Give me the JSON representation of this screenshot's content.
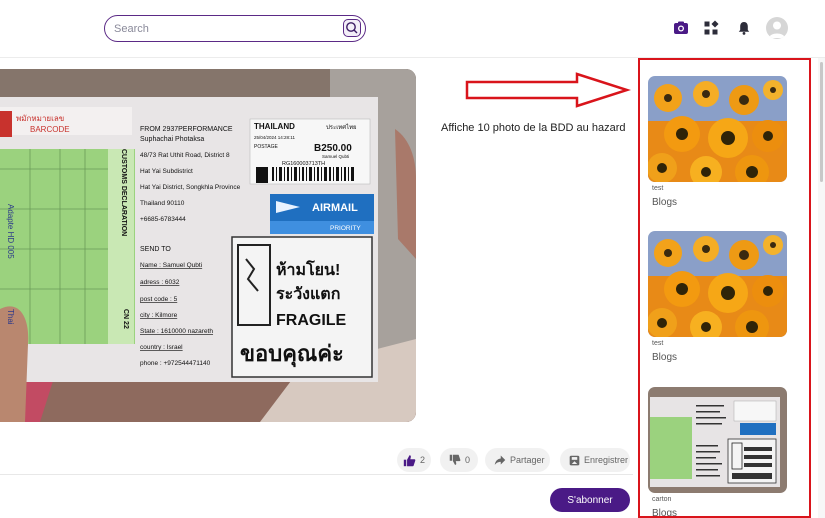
{
  "header": {
    "search": {
      "placeholder": "Search",
      "value": ""
    },
    "icons": [
      "camera-icon",
      "apps-icon",
      "bell-icon",
      "avatar-icon"
    ]
  },
  "main_photo": {
    "sender_label": "FROM 2937PERFORMANCE",
    "sender_name": "Suphachai Photaksa",
    "sender_address_1": "48/73 Rat Uthit Road, District 8",
    "sender_address_2": "Hat Yai Subdistrict",
    "sender_address_3": "Hat Yai District, Songkhla Province",
    "sender_address_4": "Thailand 90110",
    "sender_phone": "+6685-6783444",
    "stamp_country": "THAILAND",
    "stamp_country_thai": "ประเทศไทย",
    "stamp_amount": "B250.00",
    "stamp_recipient": "Samuel Qubti",
    "stamp_date": "25/04/2024 14:28:11",
    "stamp_postage": "POSTAGE",
    "tracking": "RG160003713TH",
    "airmail": "AIRMAIL",
    "priority": "PRIORITY",
    "send_to": "SEND TO",
    "to_name": "Name : Samuel Qubti",
    "to_adress": "adress : 6032",
    "to_post": "post code : 5",
    "to_city": "city : Kilmore",
    "to_state": "State : 1610000 nazareth",
    "to_country": "country : Israel",
    "to_phone": "phone : +972544471140",
    "fragile_thai_1": "ห้ามโยน!",
    "fragile_thai_2": "ระวังแตก",
    "fragile": "FRAGILE",
    "fragile_thai_3": "ขอบคุณค่ะ",
    "barcode_thai": "พมักหมายเลข",
    "barcode": "BARCODE",
    "customs": "CUSTOMS DECLARATION",
    "handwritten_1": "Adapte HD 005",
    "handwritten_2": "Thai",
    "cn_code": "CN 22"
  },
  "annotation": "Affiche 10 photo de la BDD au hazard",
  "actions": {
    "like_count": "2",
    "dislike_count": "0",
    "share_label": "Partager",
    "save_label": "Enregistrer"
  },
  "subscribe_label": "S'abonner",
  "sidebar": {
    "items": [
      {
        "title": "test",
        "category": "Blogs",
        "image": "orange-flowers"
      },
      {
        "title": "test",
        "category": "Blogs",
        "image": "orange-flowers"
      },
      {
        "title": "carton",
        "category": "Blogs",
        "image": "parcel"
      }
    ]
  },
  "colors": {
    "brand_purple": "#4a1a86",
    "annotation_red": "#d9141b"
  }
}
